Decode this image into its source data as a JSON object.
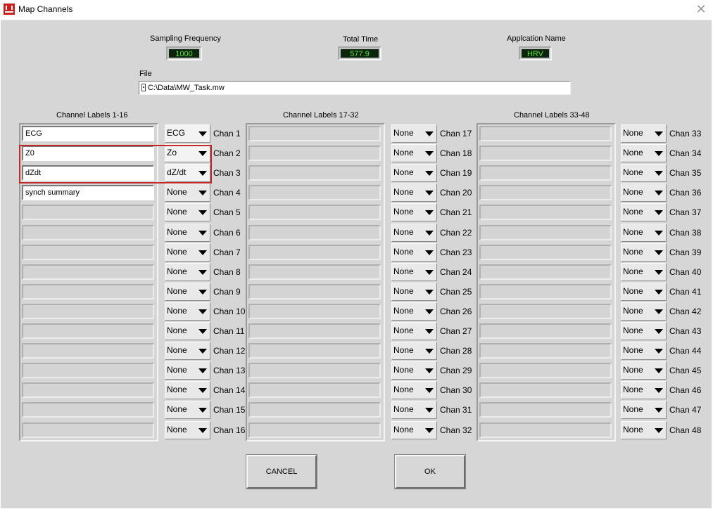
{
  "window": {
    "title": "Map Channels",
    "close_glyph": "✕",
    "icon": "app-logo-icon"
  },
  "header": {
    "sampling_frequency": {
      "label": "Sampling Frequency",
      "value": "1000"
    },
    "total_time": {
      "label": "Total Time",
      "value": "577.9"
    },
    "application_name": {
      "label": "Applcation Name",
      "value": "HRV"
    }
  },
  "file": {
    "label": "File",
    "value": "C:\\Data\\MW_Task.mw"
  },
  "groups": [
    {
      "header": "Channel Labels 1-16",
      "labels": [
        "ECG",
        "Z0",
        "dZdt",
        "synch summary",
        "",
        "",
        "",
        "",
        "",
        "",
        "",
        "",
        "",
        "",
        "",
        ""
      ],
      "selections": [
        "ECG",
        "Zo",
        "dZ/dt",
        "None",
        "None",
        "None",
        "None",
        "None",
        "None",
        "None",
        "None",
        "None",
        "None",
        "None",
        "None",
        "None"
      ],
      "channels": [
        "Chan 1",
        "Chan 2",
        "Chan 3",
        "Chan 4",
        "Chan 5",
        "Chan 6",
        "Chan 7",
        "Chan 8",
        "Chan 9",
        "Chan 10",
        "Chan 11",
        "Chan 12",
        "Chan 13",
        "Chan 14",
        "Chan 15",
        "Chan 16"
      ]
    },
    {
      "header": "Channel Labels 17-32",
      "labels": [
        "",
        "",
        "",
        "",
        "",
        "",
        "",
        "",
        "",
        "",
        "",
        "",
        "",
        "",
        "",
        ""
      ],
      "selections": [
        "None",
        "None",
        "None",
        "None",
        "None",
        "None",
        "None",
        "None",
        "None",
        "None",
        "None",
        "None",
        "None",
        "None",
        "None",
        "None"
      ],
      "channels": [
        "Chan 17",
        "Chan 18",
        "Chan 19",
        "Chan 20",
        "Chan 21",
        "Chan 22",
        "Chan 23",
        "Chan 24",
        "Chan 25",
        "Chan 26",
        "Chan 27",
        "Chan 28",
        "Chan 29",
        "Chan 30",
        "Chan 31",
        "Chan 32"
      ]
    },
    {
      "header": "Channel Labels 33-48",
      "labels": [
        "",
        "",
        "",
        "",
        "",
        "",
        "",
        "",
        "",
        "",
        "",
        "",
        "",
        "",
        "",
        ""
      ],
      "selections": [
        "None",
        "None",
        "None",
        "None",
        "None",
        "None",
        "None",
        "None",
        "None",
        "None",
        "None",
        "None",
        "None",
        "None",
        "None",
        "None"
      ],
      "channels": [
        "Chan 33",
        "Chan 34",
        "Chan 35",
        "Chan 36",
        "Chan 37",
        "Chan 38",
        "Chan 39",
        "Chan 40",
        "Chan 41",
        "Chan 42",
        "Chan 43",
        "Chan 44",
        "Chan 45",
        "Chan 46",
        "Chan 47",
        "Chan 48"
      ]
    }
  ],
  "buttons": {
    "cancel": "CANCEL",
    "ok": "OK"
  },
  "colors": {
    "indicator_bg": "#0b240b",
    "indicator_text": "#59e83a",
    "highlight": "#c22a2a",
    "app_icon": "#c8201e"
  }
}
